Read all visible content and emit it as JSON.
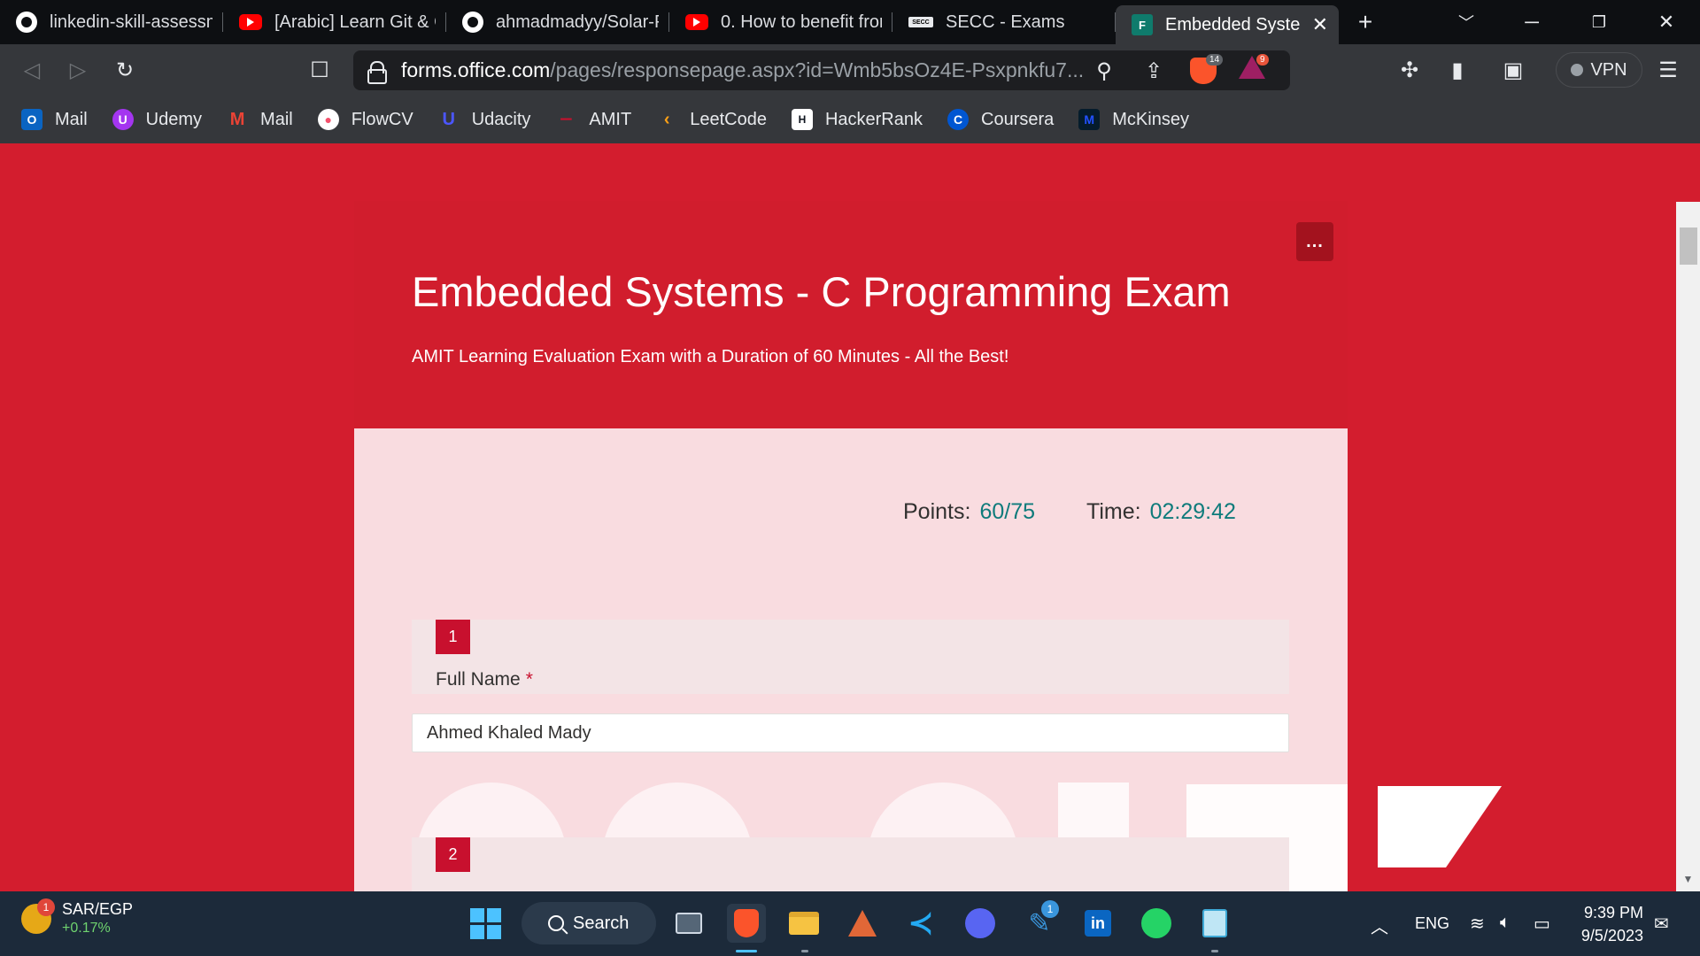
{
  "tabs": [
    {
      "title": "linkedin-skill-assessm",
      "icon": "github-icon",
      "active": false
    },
    {
      "title": "[Arabic] Learn Git & C",
      "icon": "youtube-icon",
      "active": false
    },
    {
      "title": "ahmadmadyy/Solar-P",
      "icon": "github-icon",
      "active": false
    },
    {
      "title": "0. How to benefit fror",
      "icon": "youtube-icon",
      "active": false
    },
    {
      "title": "SECC - Exams",
      "icon": "secc-icon",
      "active": false
    },
    {
      "title": "Embedded Syste",
      "icon": "forms-icon",
      "active": true
    }
  ],
  "toolbar": {
    "url_host": "forms.office.com",
    "url_path": "/pages/responsepage.aspx?id=Wmb5bsOz4E-Psxpnkfu7...",
    "shield_count": "14",
    "rewards_count": "9",
    "vpn_label": "VPN"
  },
  "bookmarks": [
    {
      "label": "Mail",
      "icon": "outlook-icon",
      "color": "#0a64c2"
    },
    {
      "label": "Udemy",
      "icon": "udemy-icon",
      "color": "#a435f0"
    },
    {
      "label": "Mail",
      "icon": "gmail-icon",
      "color": "#ea4335"
    },
    {
      "label": "FlowCV",
      "icon": "flowcv-icon",
      "color": "#f4516c"
    },
    {
      "label": "Udacity",
      "icon": "udacity-icon",
      "color": "#2015ff"
    },
    {
      "label": "AMIT",
      "icon": "amit-icon",
      "color": "#c8102e"
    },
    {
      "label": "LeetCode",
      "icon": "leetcode-icon",
      "color": "#ffa116"
    },
    {
      "label": "HackerRank",
      "icon": "hackerrank-icon",
      "color": "#1ba94c"
    },
    {
      "label": "Coursera",
      "icon": "coursera-icon",
      "color": "#0056d2"
    },
    {
      "label": "McKinsey",
      "icon": "mckinsey-icon",
      "color": "#051c2c"
    }
  ],
  "form": {
    "title": "Embedded Systems - C Programming Exam",
    "subtitle": "AMIT Learning Evaluation Exam with a Duration of 60 Minutes - All the Best!",
    "menu_label": "...",
    "points_label": "Points:",
    "points_value": "60/75",
    "time_label": "Time:",
    "time_value": "02:29:42",
    "questions": [
      {
        "number": "1",
        "title": "Full Name",
        "required": "*",
        "answer": "Ahmed Khaled Mady"
      },
      {
        "number": "2",
        "title": "",
        "required": "",
        "answer": ""
      }
    ],
    "accent_color": "#d31d2e"
  },
  "taskbar": {
    "ticker_name": "SAR/EGP",
    "ticker_change": "+0.17%",
    "ticker_notification": "1",
    "search_label": "Search",
    "lang": "ENG",
    "time": "9:39 PM",
    "date": "9/5/2023",
    "badge_tools": "1"
  }
}
